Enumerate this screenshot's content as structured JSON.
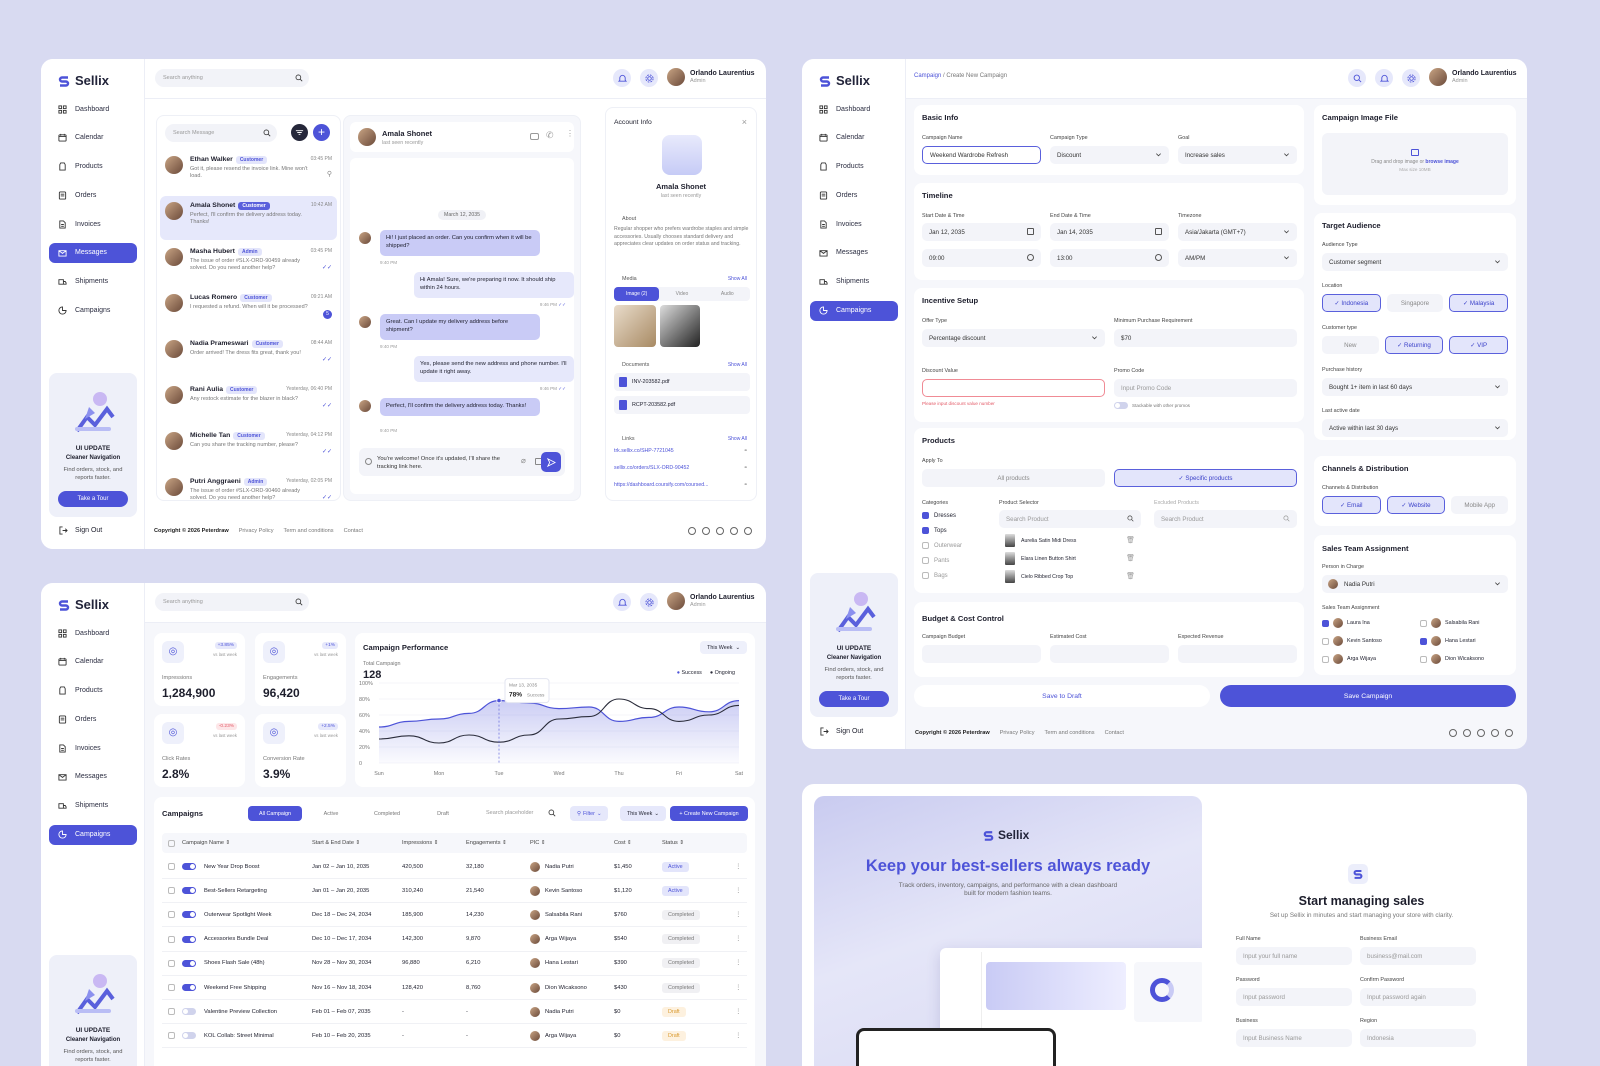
{
  "brand": "Sellix",
  "user": {
    "name": "Orlando Laurentius",
    "role": "Admin"
  },
  "nav": [
    "Dashboard",
    "Calendar",
    "Products",
    "Orders",
    "Invoices",
    "Messages",
    "Shipments",
    "Campaigns"
  ],
  "signout": "Sign Out",
  "promo": {
    "title": "UI UPDATE",
    "subtitle": "Cleaner Navigation",
    "desc": "Find orders, stock, and reports faster.",
    "btn": "Take a Tour"
  },
  "search": "Search anything",
  "footer": {
    "copy": "Copyright © 2026 Peterdraw",
    "privacy": "Privacy Policy",
    "terms": "Term and conditions",
    "contact": "Contact"
  },
  "messages": {
    "search": "Search Message",
    "list": [
      {
        "name": "Ethan Walker",
        "tag": "Customer",
        "time": "03:45 PM",
        "text": "Got it, please resend the invoice link. Mine won't load.",
        "status": "pin"
      },
      {
        "name": "Amala Shonet",
        "tag": "Customer",
        "time": "10:42 AM",
        "text": "Perfect, I'll confirm the delivery address today. Thanks!",
        "status": ""
      },
      {
        "name": "Masha Hubert",
        "tag": "Admin",
        "time": "03:45 PM",
        "text": "The issue of order #SLX-ORD-90459 already solved. Do you need another help?",
        "status": "read"
      },
      {
        "name": "Lucas Romero",
        "tag": "Customer",
        "time": "09:21 AM",
        "text": "I requested a refund. When will it be processed?",
        "status": "5"
      },
      {
        "name": "Nadia Prameswari",
        "tag": "Customer",
        "time": "08:44 AM",
        "text": "Order arrived! The dress fits great, thank you!",
        "status": "read"
      },
      {
        "name": "Rani Aulia",
        "tag": "Customer",
        "time": "Yesterday, 06:40 PM",
        "text": "Any restock estimate for the blazer in black?",
        "status": "read"
      },
      {
        "name": "Michelle Tan",
        "tag": "Customer",
        "time": "Yesterday, 04:12 PM",
        "text": "Can you share the tracking number, please?",
        "status": "read"
      },
      {
        "name": "Putri Anggraeni",
        "tag": "Admin",
        "time": "Yesterday, 02:05 PM",
        "text": "The issue of order #SLX-ORD-90460 already solved. Do you need another help?",
        "status": "read"
      }
    ],
    "chat": {
      "name": "Amala Shonet",
      "seen": "last seen recently",
      "date": "March 12, 2035",
      "bubbles": [
        {
          "side": "in",
          "text": "Hi! I just placed an order. Can you confirm when it will be shipped?",
          "time": "9:40 PM"
        },
        {
          "side": "out",
          "text": "Hi Amala! Sure, we're preparing it now. It should ship within 24 hours.",
          "time": "9:46 PM"
        },
        {
          "side": "in",
          "text": "Great. Can I update my delivery address before shipment?",
          "time": "9:40 PM"
        },
        {
          "side": "out",
          "text": "Yes, please send the new address and phone number. I'll update it right away.",
          "time": "9:46 PM"
        },
        {
          "side": "in",
          "text": "Perfect, I'll confirm the delivery address today. Thanks!",
          "time": "9:40 PM"
        }
      ],
      "input": "You're welcome! Once it's updated, I'll share the tracking link here."
    },
    "account": {
      "title": "Account Info",
      "name": "Amala Shonet",
      "seen": "last seen recently",
      "about_label": "About",
      "about": "Regular shopper who prefers wardrobe staples and simple accessories. Usually chooses standard delivery and appreciates clear updates on order status and tracking.",
      "media": "Media",
      "show_all": "Show All",
      "tabs": [
        "Image (2)",
        "Video",
        "Audio"
      ],
      "documents": "Documents",
      "docs": [
        "INV-203582.pdf",
        "RCPT-203582.pdf"
      ],
      "links_label": "Links",
      "links": [
        "trk.sellix.co/SHP-7721045",
        "sellix.co/orders/SLX-ORD-90452",
        "https://dashboard.coursify.com/coursed..."
      ]
    }
  },
  "campaign": {
    "breadcrumb": {
      "parent": "Campaign",
      "current": "/ Create New Campaign"
    },
    "basic": {
      "title": "Basic Info",
      "name_label": "Campaign Name",
      "name": "Weekend Wardrobe Refresh",
      "type_label": "Campaign Type",
      "type": "Discount",
      "goal_label": "Goal",
      "goal": "Increase sales"
    },
    "timeline": {
      "title": "Timeline",
      "start_label": "Start Date & Time",
      "start_date": "Jan 12, 2035",
      "start_time": "09:00",
      "end_label": "End Date & Time",
      "end_date": "Jan 14, 2035",
      "end_time": "13:00",
      "tz_label": "Timezone",
      "tz": "Asia/Jakarta (GMT+7)",
      "ampm": "AM/PM"
    },
    "incentive": {
      "title": "Incentive Setup",
      "offer_label": "Offer Type",
      "offer": "Percentage discount",
      "min_label": "Minimum Purchase Requirement",
      "min": "$70",
      "discount_label": "Discount Value",
      "error": "Please input discount value number",
      "promo_label": "Promo Code",
      "promo_ph": "Input Promo Code",
      "stack": "Stackable with other promos"
    },
    "products": {
      "title": "Products",
      "apply": "Apply To",
      "all": "All products",
      "specific": "✓ Specific products",
      "cat_label": "Categories",
      "cats": [
        {
          "n": "Dresses",
          "on": true
        },
        {
          "n": "Tops",
          "on": true
        },
        {
          "n": "Outerwear",
          "on": false
        },
        {
          "n": "Pants",
          "on": false
        },
        {
          "n": "Bags",
          "on": false
        }
      ],
      "sel_label": "Product Selector",
      "sel_ph": "Search Product",
      "items": [
        "Aurelia Satin Midi Dress",
        "Elara Linen Button Shirt",
        "Cielo Ribbed Crop Top"
      ],
      "excl_label": "Excluded Products",
      "excl_ph": "Search Product"
    },
    "budget": {
      "title": "Budget & Cost Control",
      "b1": "Campaign Budget",
      "b2": "Estimated Cost",
      "b3": "Expected Revenue"
    },
    "image": {
      "title": "Campaign Image File",
      "drop": "Drag and drop image or",
      "browse": "browse image",
      "max": "Max size 10MB"
    },
    "audience": {
      "title": "Target Audience",
      "type_label": "Audience Type",
      "type": "Customer segment",
      "loc_label": "Location",
      "locs": [
        {
          "n": "✓ Indonesia",
          "on": true
        },
        {
          "n": "Singapore",
          "on": false
        },
        {
          "n": "✓ Malaysia",
          "on": true
        }
      ],
      "ct_label": "Customer type",
      "cts": [
        {
          "n": "New",
          "on": false
        },
        {
          "n": "✓ Returning",
          "on": true
        },
        {
          "n": "✓ VIP",
          "on": true
        }
      ],
      "ph_label": "Purchase history",
      "ph": "Bought 1+ item in last 60 days",
      "la_label": "Last active date",
      "la": "Active within last 30 days"
    },
    "channels": {
      "title": "Channels & Distribution",
      "label": "Channels & Distribution",
      "items": [
        {
          "n": "✓ Email",
          "on": true
        },
        {
          "n": "✓ Website",
          "on": true
        },
        {
          "n": "Mobile App",
          "on": false
        }
      ]
    },
    "team": {
      "title": "Sales Team Assignment",
      "pic_label": "Person in Charge",
      "pic": "Nadia Putri",
      "sta_label": "Sales Team Assignment",
      "members": [
        {
          "n": "Laura Ina",
          "on": true
        },
        {
          "n": "Salsabila Rani",
          "on": false
        },
        {
          "n": "Kevin Santoso",
          "on": false
        },
        {
          "n": "Hana Lestari",
          "on": true
        },
        {
          "n": "Arga Wijaya",
          "on": false
        },
        {
          "n": "Dion Wicaksono",
          "on": false
        }
      ]
    },
    "draft": "Save to Draft",
    "save": "Save Campaign"
  },
  "dash": {
    "stats": [
      {
        "label": "Impressions",
        "value": "1,284,900",
        "delta": "+3.85%",
        "vs": "vs last week",
        "up": true
      },
      {
        "label": "Engagements",
        "value": "96,420",
        "delta": "+1%",
        "vs": "vs last week",
        "up": true
      },
      {
        "label": "Click Rates",
        "value": "2.8%",
        "delta": "-0.23%",
        "vs": "vs last week",
        "up": false
      },
      {
        "label": "Conversion Rate",
        "value": "3.9%",
        "delta": "+2.5%",
        "vs": "vs last week",
        "up": true
      }
    ],
    "perf": {
      "title": "Campaign Performance",
      "period": "This Week",
      "total_label": "Total Campaign",
      "total": "128",
      "legend": [
        "Success",
        "Ongoing"
      ],
      "tip_date": "Mar 13, 2035",
      "tip_val": "78%",
      "tip_lbl": "Success"
    },
    "table": {
      "title": "Campaigns",
      "tabs": [
        "All Campaign",
        "Active",
        "Completed",
        "Draft"
      ],
      "search": "Search placeholder",
      "filter": "Filter",
      "week": "This Week",
      "create": "+ Create New Campaign",
      "cols": [
        "Campaign Name ⇕",
        "Start & End Date ⇕",
        "Impressions ⇕",
        "Engagements ⇕",
        "PIC ⇕",
        "Cost ⇕",
        "Status ⇕"
      ],
      "rows": [
        {
          "on": true,
          "name": "New Year Drop Boost",
          "date": "Jan 02 – Jan 10, 2035",
          "imp": "420,500",
          "eng": "32,180",
          "pic": "Nadia Putri",
          "cost": "$1,450",
          "status": "Active"
        },
        {
          "on": true,
          "name": "Best-Sellers Retargeting",
          "date": "Jan 01 – Jan 20, 2035",
          "imp": "310,240",
          "eng": "21,540",
          "pic": "Kevin Santoso",
          "cost": "$1,120",
          "status": "Active"
        },
        {
          "on": true,
          "name": "Outerwear Spotlight Week",
          "date": "Dec 18 – Dec 24, 2034",
          "imp": "185,900",
          "eng": "14,230",
          "pic": "Salsabila Rani",
          "cost": "$760",
          "status": "Completed"
        },
        {
          "on": true,
          "name": "Accessories Bundle Deal",
          "date": "Dec 10 – Dec 17, 2034",
          "imp": "142,300",
          "eng": "9,870",
          "pic": "Arga Wijaya",
          "cost": "$540",
          "status": "Completed"
        },
        {
          "on": true,
          "name": "Shoes Flash Sale (48h)",
          "date": "Nov 28 – Nov 30, 2034",
          "imp": "96,880",
          "eng": "6,210",
          "pic": "Hana Lestari",
          "cost": "$390",
          "status": "Completed"
        },
        {
          "on": true,
          "name": "Weekend Free Shipping",
          "date": "Nov 16 – Nov 18, 2034",
          "imp": "128,420",
          "eng": "8,760",
          "pic": "Dion Wicaksono",
          "cost": "$430",
          "status": "Completed"
        },
        {
          "on": false,
          "name": "Valentine Preview Collection",
          "date": "Feb 01 – Feb 07, 2035",
          "imp": "-",
          "eng": "-",
          "pic": "Nadia Putri",
          "cost": "$0",
          "status": "Draft"
        },
        {
          "on": false,
          "name": "KOL Collab: Street Minimal",
          "date": "Feb 10 – Feb 20, 2035",
          "imp": "-",
          "eng": "-",
          "pic": "Arga Wijaya",
          "cost": "$0",
          "status": "Draft"
        }
      ]
    }
  },
  "signup": {
    "headline": "Keep your best-sellers always ready",
    "sub": "Track orders, inventory, campaigns, and performance with a clean dashboard built for modern fashion teams.",
    "title": "Start managing sales",
    "desc": "Set up Sellix in minutes and start managing your store with clarity.",
    "fields": [
      {
        "l": "Full Name",
        "p": "Input your full name"
      },
      {
        "l": "Business Email",
        "p": "business@mail.com"
      },
      {
        "l": "Password",
        "p": "Input password"
      },
      {
        "l": "Confirm Password",
        "p": "Input password again"
      },
      {
        "l": "Business",
        "p": "Input Business Name"
      },
      {
        "l": "Region",
        "p": "Indonesia"
      }
    ]
  },
  "chart_data": {
    "type": "line",
    "title": "Campaign Performance",
    "categories": [
      "Sun",
      "Mon",
      "Tue",
      "Wed",
      "Thu",
      "Fri",
      "Sat"
    ],
    "ylim": [
      0,
      100
    ],
    "yticks": [
      "100%",
      "80%",
      "60%",
      "40%",
      "20%",
      "0"
    ],
    "series": [
      {
        "name": "Success",
        "x": [
          0,
          0.5,
          1,
          1.5,
          2,
          2.5,
          3,
          3.5,
          4,
          4.5,
          5,
          5.5,
          6
        ],
        "values": [
          45,
          52,
          55,
          62,
          78,
          75,
          68,
          70,
          52,
          57,
          70,
          64,
          78
        ],
        "color": "#4d53d8"
      },
      {
        "name": "Ongoing",
        "x": [
          0,
          0.5,
          1,
          1.5,
          2,
          2.5,
          3,
          3.5,
          4,
          4.5,
          5,
          5.5,
          6
        ],
        "values": [
          30,
          34,
          25,
          35,
          26,
          35,
          55,
          58,
          80,
          68,
          52,
          60,
          72
        ],
        "color": "#2a2c3a"
      }
    ]
  }
}
